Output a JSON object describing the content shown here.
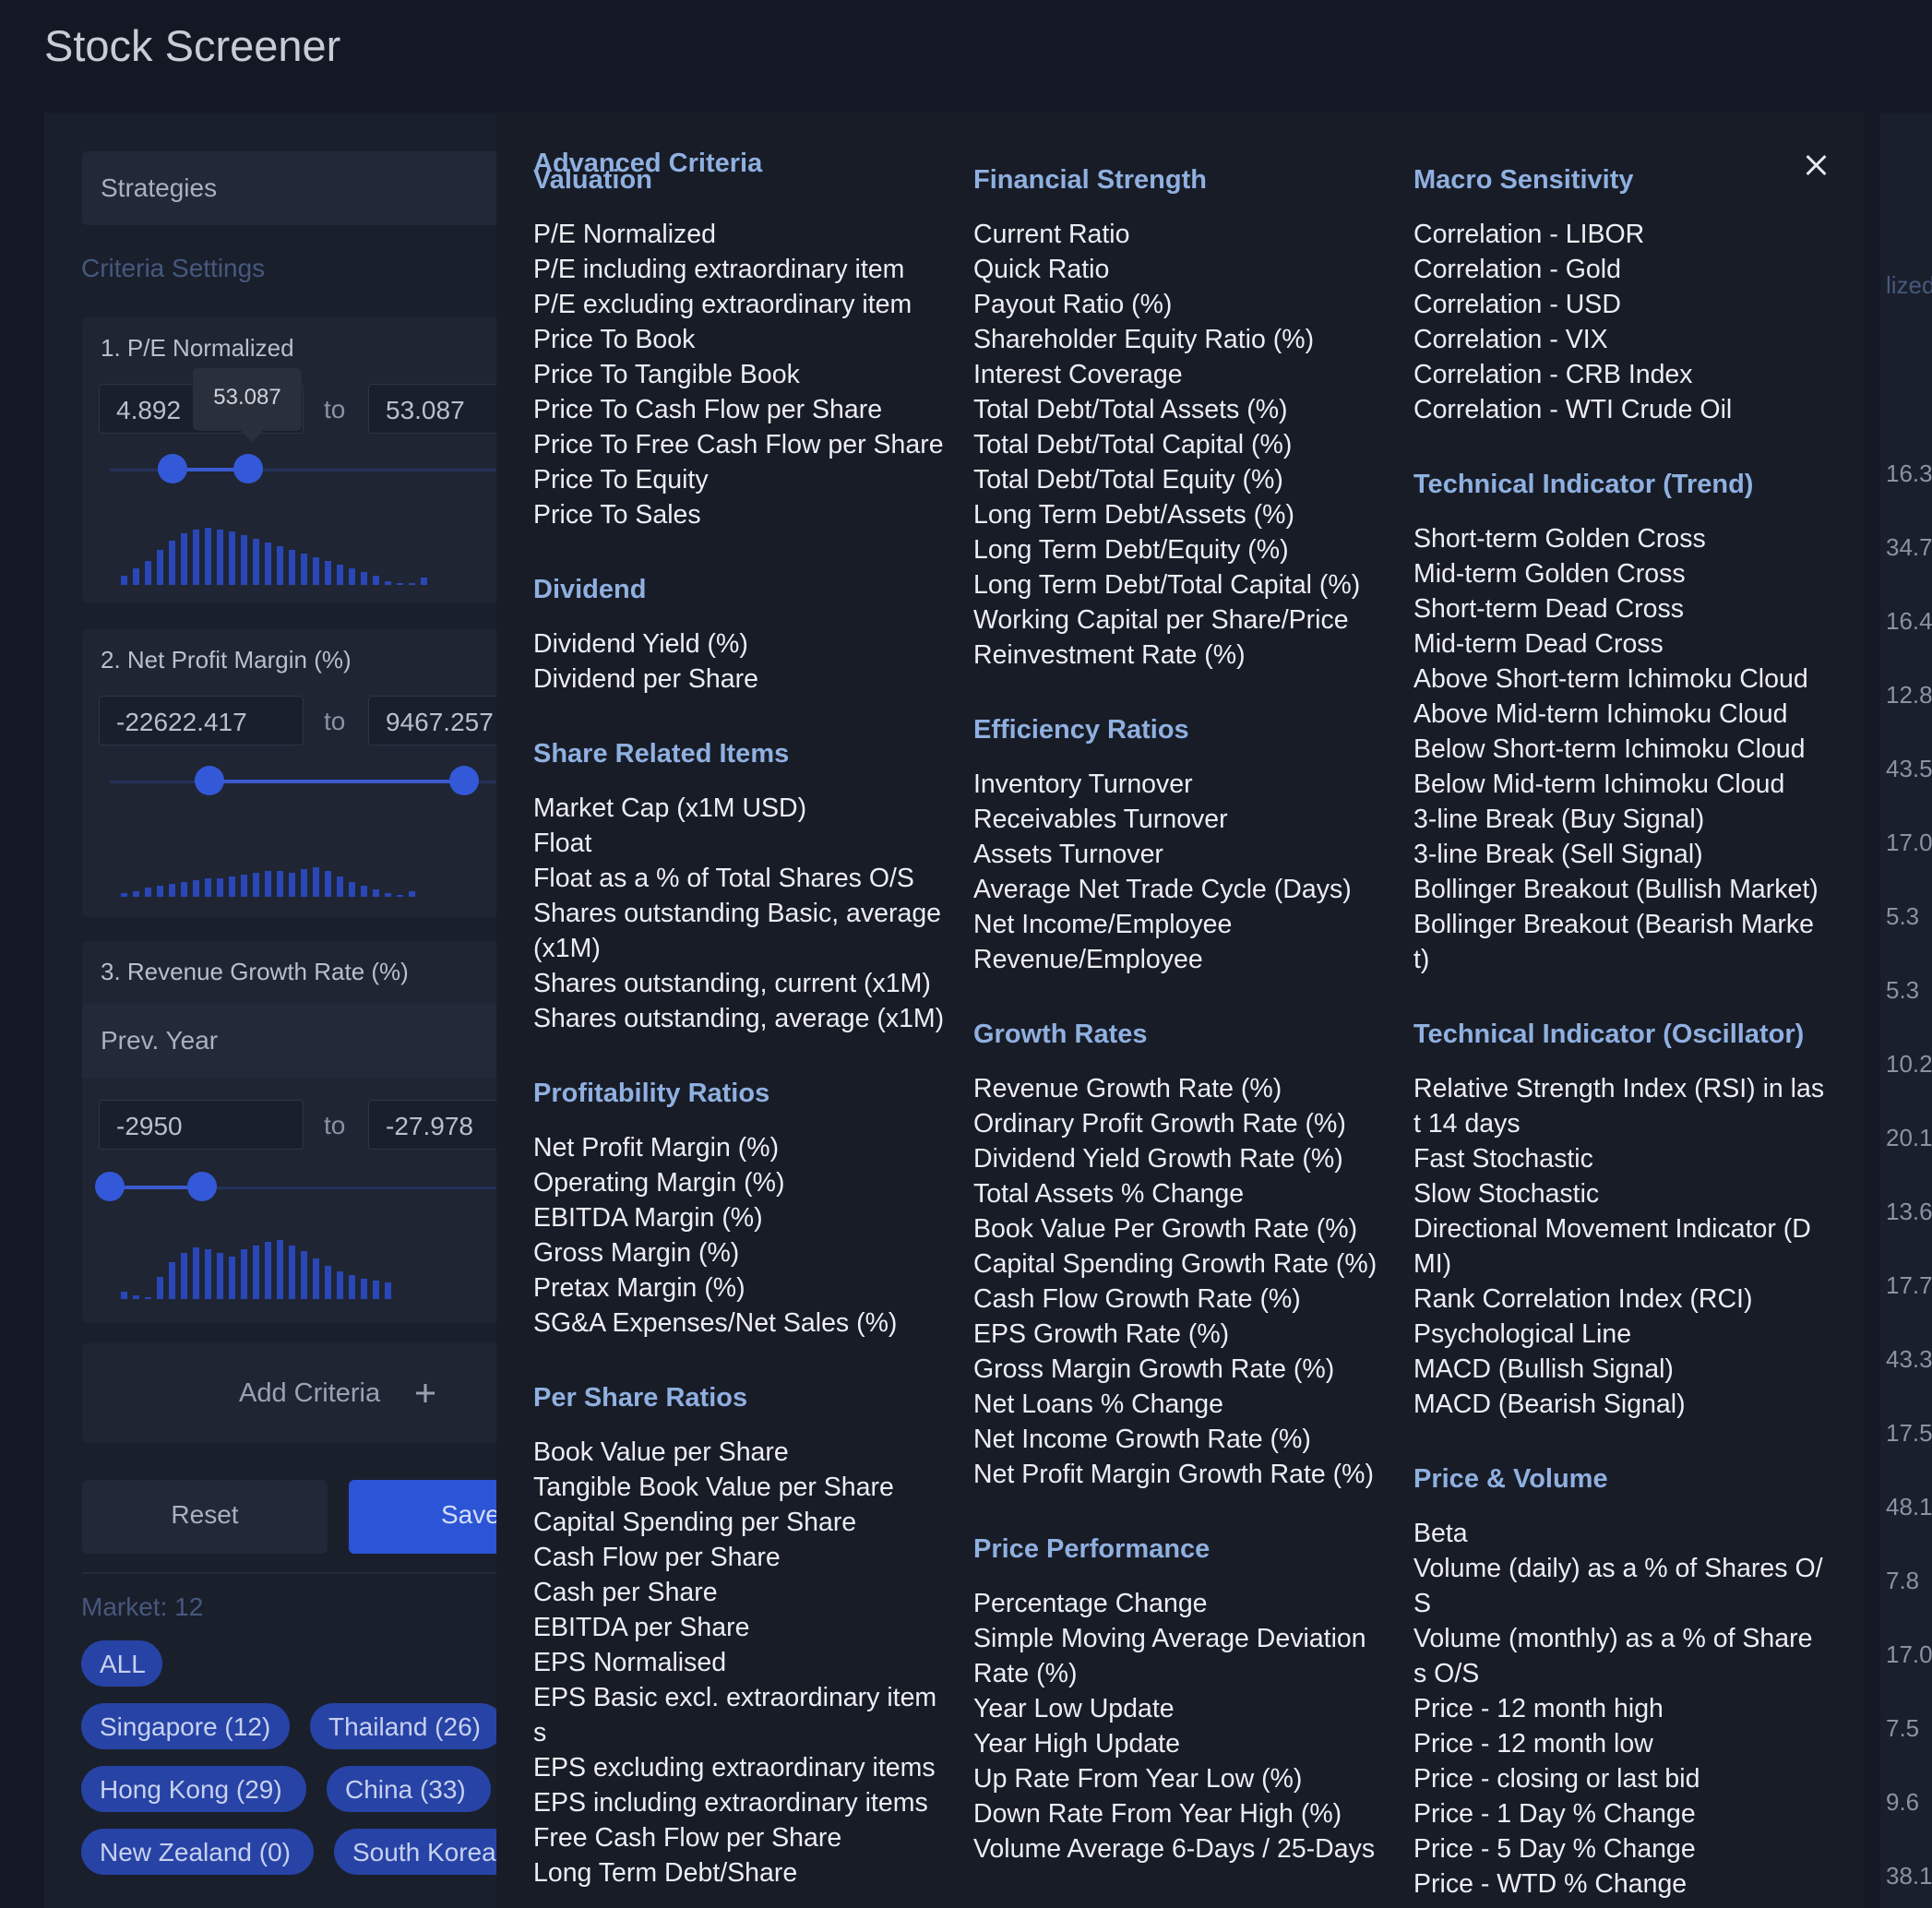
{
  "app": {
    "title": "Stock Screener"
  },
  "left_panel": {
    "strategies_label": "Strategies",
    "criteria_settings_label": "Criteria Settings",
    "criteria": [
      {
        "title": "1. P/E Normalized",
        "min": "4.892",
        "max": "53.087",
        "to": "to",
        "tooltip": "53.087"
      },
      {
        "title": "2. Net Profit Margin (%)",
        "min": "-22622.417",
        "max": "9467.257",
        "to": "to"
      },
      {
        "title": "3. Revenue Growth Rate (%)",
        "period": "Prev. Year",
        "min": "-2950",
        "max": "-27.978",
        "to": "to"
      }
    ],
    "add_criteria_label": "Add Criteria",
    "add_icon": "plus-icon",
    "reset_label": "Reset",
    "save_label": "Save",
    "market_label": "Market: 12",
    "markets": [
      "ALL",
      "Singapore (12)",
      "Thailand (26)",
      "Hong Kong (29)",
      "China (33)",
      "New Zealand (0)",
      "South Korea"
    ]
  },
  "right_strip": {
    "header": "lized",
    "values": [
      "16.3",
      "34.7",
      "16.4",
      "12.8",
      "43.5",
      "17.0",
      "5.3",
      "5.3",
      "10.2",
      "20.1",
      "13.6",
      "17.7",
      "43.3",
      "17.5",
      "48.1",
      "7.8",
      "17.0",
      "7.5",
      "9.6",
      "38.1"
    ]
  },
  "modal": {
    "title": "Advanced Criteria",
    "close_icon": "close-icon",
    "columns": [
      {
        "groups": [
          {
            "title": "Valuation",
            "items": [
              "P/E Normalized",
              "P/E including extraordinary item",
              "P/E excluding extraordinary item",
              "Price To Book",
              "Price To Tangible Book",
              "Price To Cash Flow per Share",
              "Price To Free Cash Flow per Share",
              "Price To Equity",
              "Price To Sales"
            ]
          },
          {
            "title": "Dividend",
            "items": [
              "Dividend Yield (%)",
              "Dividend per Share"
            ]
          },
          {
            "title": "Share Related Items",
            "items": [
              "Market Cap (x1M USD)",
              "Float",
              "Float as a % of Total Shares O/S",
              "Shares outstanding Basic, average",
              "(x1M)",
              "Shares outstanding, current (x1M)",
              "Shares outstanding, average (x1M)"
            ]
          },
          {
            "title": "Profitability Ratios",
            "items": [
              "Net Profit Margin (%)",
              "Operating Margin (%)",
              "EBITDA Margin (%)",
              "Gross Margin (%)",
              "Pretax Margin (%)",
              "SG&A Expenses/Net Sales (%)"
            ]
          },
          {
            "title": "Per Share Ratios",
            "items": [
              "Book Value per Share",
              "Tangible Book Value per Share",
              "Capital Spending per Share",
              "Cash Flow per Share",
              "Cash per Share",
              "EBITDA per Share",
              "EPS Normalised",
              "EPS Basic excl. extraordinary item",
              "s",
              "EPS excluding extraordinary items",
              "EPS including extraordinary items",
              "Free Cash Flow per Share",
              "Long Term Debt/Share"
            ]
          }
        ]
      },
      {
        "groups": [
          {
            "title": "Financial Strength",
            "items": [
              "Current Ratio",
              "Quick Ratio",
              "Payout Ratio (%)",
              "Shareholder Equity Ratio (%)",
              "Interest Coverage",
              "Total Debt/Total Assets (%)",
              "Total Debt/Total Capital (%)",
              "Total Debt/Total Equity (%)",
              "Long Term Debt/Assets (%)",
              "Long Term Debt/Equity (%)",
              "Long Term Debt/Total Capital (%)",
              "Working Capital per Share/Price",
              "Reinvestment Rate (%)"
            ]
          },
          {
            "title": "Efficiency Ratios",
            "items": [
              "Inventory Turnover",
              "Receivables Turnover",
              "Assets Turnover",
              "Average Net Trade Cycle (Days)",
              "Net Income/Employee",
              "Revenue/Employee"
            ]
          },
          {
            "title": "Growth Rates",
            "items": [
              "Revenue Growth Rate (%)",
              "Ordinary Profit Growth Rate (%)",
              "Dividend Yield Growth Rate (%)",
              "Total Assets % Change",
              "Book Value Per Growth Rate (%)",
              "Capital Spending Growth Rate (%)",
              "Cash Flow Growth Rate (%)",
              "EPS Growth Rate (%)",
              "Gross Margin Growth Rate (%)",
              "Net Loans % Change",
              "Net Income Growth Rate (%)",
              "Net Profit Margin Growth Rate (%)"
            ]
          },
          {
            "title": "Price Performance",
            "items": [
              "Percentage Change",
              "Simple Moving Average Deviation",
              "Rate (%)",
              "Year Low Update",
              "Year High Update",
              "Up Rate From Year Low (%)",
              "Down Rate From Year High (%)",
              "Volume Average 6-Days / 25-Days"
            ]
          }
        ]
      },
      {
        "groups": [
          {
            "title": "Macro Sensitivity",
            "items": [
              "Correlation - LIBOR",
              "Correlation - Gold",
              "Correlation - USD",
              "Correlation - VIX",
              "Correlation - CRB Index",
              "Correlation - WTI Crude Oil"
            ]
          },
          {
            "title": "Technical Indicator (Trend)",
            "items": [
              "Short-term Golden Cross",
              "Mid-term Golden Cross",
              "Short-term Dead Cross",
              "Mid-term Dead Cross",
              "Above Short-term Ichimoku Cloud",
              "Above Mid-term Ichimoku Cloud",
              "Below Short-term Ichimoku Cloud",
              "Below Mid-term Ichimoku Cloud",
              "3-line Break (Buy Signal)",
              "3-line Break (Sell Signal)",
              "Bollinger Breakout (Bullish Market)",
              "Bollinger Breakout (Bearish Marke",
              "t)"
            ]
          },
          {
            "title": "Technical Indicator (Oscillator)",
            "items": [
              "Relative Strength Index (RSI) in las",
              "t 14 days",
              "Fast Stochastic",
              "Slow Stochastic",
              "Directional Movement Indicator (D",
              "MI)",
              "Rank Correlation Index (RCI)",
              "Psychological Line",
              "MACD (Bullish Signal)",
              "MACD (Bearish Signal)"
            ]
          },
          {
            "title": "Price & Volume",
            "items": [
              "Beta",
              "Volume (daily) as a % of Shares O/",
              "S",
              "Volume (monthly) as a % of Share",
              "s O/S",
              "Price - 12 month high",
              "Price - 12 month low",
              "Price - closing or last bid",
              "Price - 1 Day % Change",
              "Price - 5 Day % Change",
              "Price - WTD % Change"
            ]
          }
        ]
      }
    ]
  }
}
